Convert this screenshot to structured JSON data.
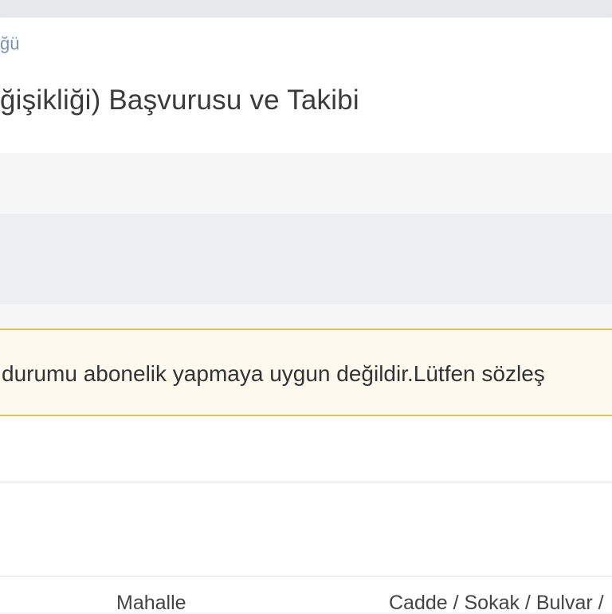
{
  "header": {
    "breadcrumb_fragment": "ğü",
    "title": "ğişikliği) Başvurusu ve Takibi"
  },
  "alert": {
    "text": " durumu abonelik yapmaya uygun değildir.Lütfen sözleş"
  },
  "address_table": {
    "columns": [
      "Mahalle",
      "Cadde / Sokak / Bulvar /"
    ]
  },
  "colors": {
    "alert_border": "#e0c153",
    "alert_background": "#fdf9ee",
    "breadcrumb": "#7c95b3"
  }
}
